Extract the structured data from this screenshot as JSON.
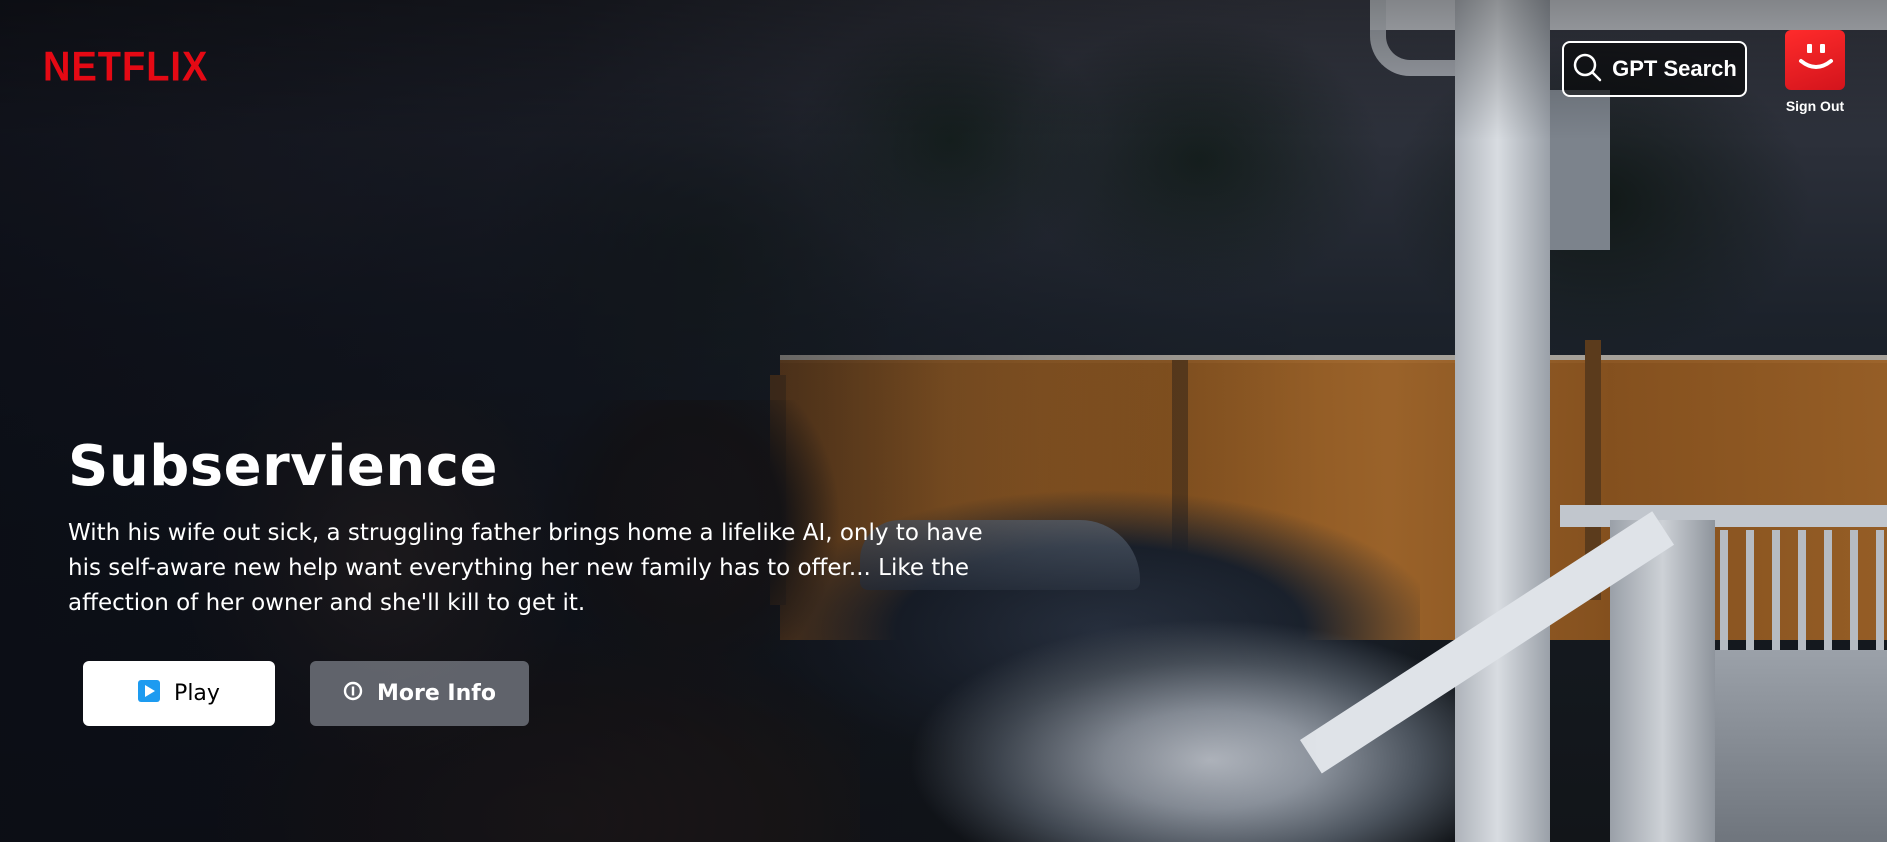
{
  "header": {
    "logo_text": "NETFLIX",
    "logo_color": "#e50914",
    "gpt_search": {
      "label": "GPT Search",
      "icon": "search-icon"
    },
    "profile": {
      "avatar_icon": "smiley-avatar-icon",
      "avatar_color": "#e50914",
      "sign_out_label": "Sign Out"
    }
  },
  "hero": {
    "title": "Subservience",
    "description": "With his wife out sick, a struggling father brings home a lifelike AI, only to have his self-aware new help want everything her new family has to offer... Like the affection of her owner and she'll kill to get it.",
    "buttons": {
      "play": {
        "label": "Play",
        "icon": "play-icon",
        "icon_color": "#1d9bf0"
      },
      "more_info": {
        "label": "More Info",
        "icon": "info-icon"
      }
    }
  }
}
